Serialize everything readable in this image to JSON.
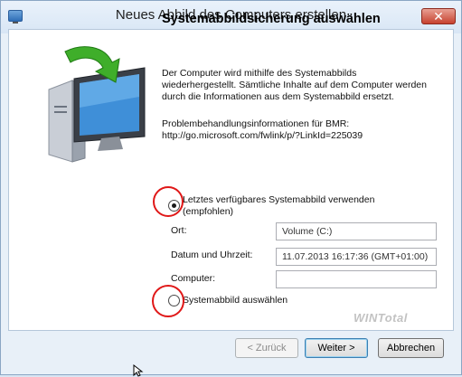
{
  "window": {
    "title": "Neues Abbild des Computers erstellen",
    "close_label": "✕"
  },
  "content": {
    "heading": "Systemabbildsicherung auswählen",
    "description": "Der Computer wird mithilfe des Systemabbilds wiederhergestellt. Sämtliche Inhalte auf dem Computer werden durch die Informationen aus dem Systemabbild ersetzt.",
    "troubleshooting": "Problembehandlungsinformationen für BMR:\nhttp://go.microsoft.com/fwlink/p/?LinkId=225039",
    "option_latest": {
      "label": "Letztes verfügbares Systemabbild verwenden (empfohlen)",
      "selected": true
    },
    "fields": {
      "location_label": "Ort:",
      "location_value": "Volume (C:)",
      "datetime_label": "Datum und Uhrzeit:",
      "datetime_value": "11.07.2013 16:17:36 (GMT+01:00)",
      "computer_label": "Computer:",
      "computer_value": ""
    },
    "option_select": {
      "label": "Systemabbild auswählen",
      "selected": false
    }
  },
  "footer": {
    "back_label": "< Zurück",
    "next_label": "Weiter >",
    "cancel_label": "Abbrechen"
  },
  "watermark": {
    "text": "WINTotal"
  },
  "colors": {
    "annotation": "#e01818",
    "accent": "#2f6fb7"
  }
}
